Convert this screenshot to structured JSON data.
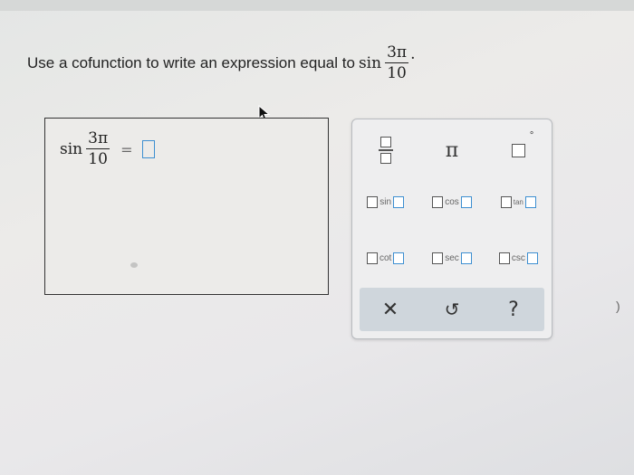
{
  "question": {
    "text": "Use a cofunction to write an expression equal to",
    "function": "sin",
    "numerator": "3π",
    "denominator": "10",
    "trailing": "."
  },
  "answer": {
    "function": "sin",
    "numerator": "3π",
    "denominator": "10",
    "equals": "="
  },
  "palette": {
    "pi": "π",
    "degree": "°",
    "trig": {
      "sin": "sin",
      "cos": "cos",
      "tan": "tan",
      "cot": "cot",
      "sec": "sec",
      "csc": "csc"
    },
    "clear": "✕",
    "undo": "↺",
    "help": "?"
  },
  "side_mark": ")",
  "colors": {
    "placeholder": "#3d8fd1",
    "help": "#3f6fae",
    "toolbar_bg": "#cfd6dc"
  }
}
